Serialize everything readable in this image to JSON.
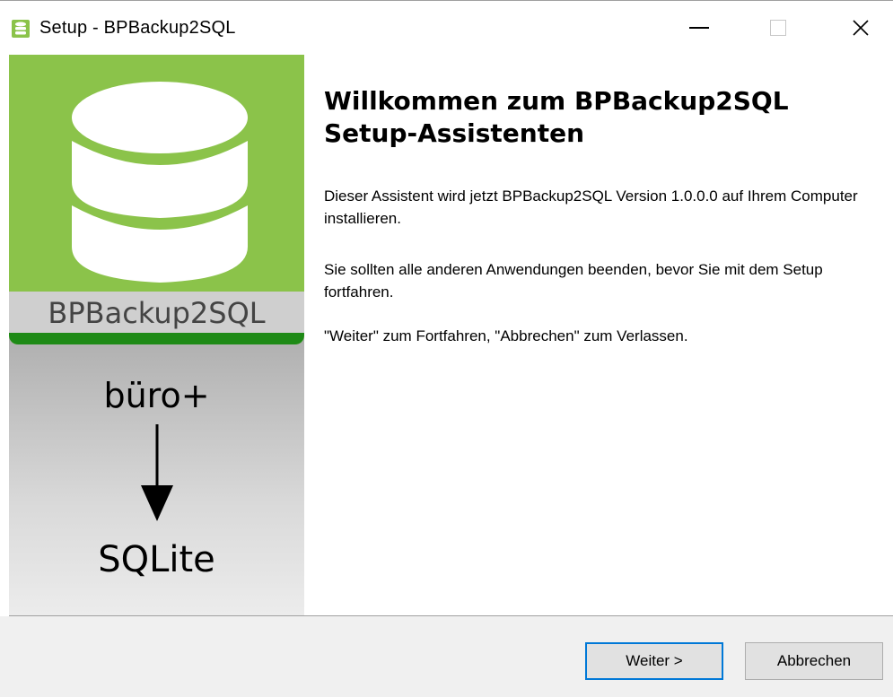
{
  "window": {
    "title": "Setup - BPBackup2SQL",
    "minimize": "—",
    "close": "✕"
  },
  "banner": {
    "product_name": "BPBackup2SQL",
    "source_label": "büro+",
    "target_label": "SQLite"
  },
  "content": {
    "heading": "Willkommen zum BPBackup2SQL Setup-Assistenten",
    "paragraph_1": "Dieser Assistent wird jetzt BPBackup2SQL Version 1.0.0.0 auf Ihrem Computer installieren.",
    "paragraph_2": "Sie sollten alle anderen Anwendungen beenden, bevor Sie mit dem Setup fortfahren.",
    "paragraph_3": "\"Weiter\" zum Fortfahren, \"Abbrechen\" zum Verlassen."
  },
  "buttons": {
    "next": "Weiter >",
    "cancel": "Abbrechen"
  },
  "colors": {
    "brand_green": "#8bc34a",
    "dark_green": "#1e8a16",
    "focus_blue": "#0078d7"
  },
  "icons": {
    "app": "database-icon",
    "minimize": "minimize-icon",
    "maximize": "maximize-icon",
    "close": "close-icon",
    "arrow": "arrow-down-icon"
  }
}
